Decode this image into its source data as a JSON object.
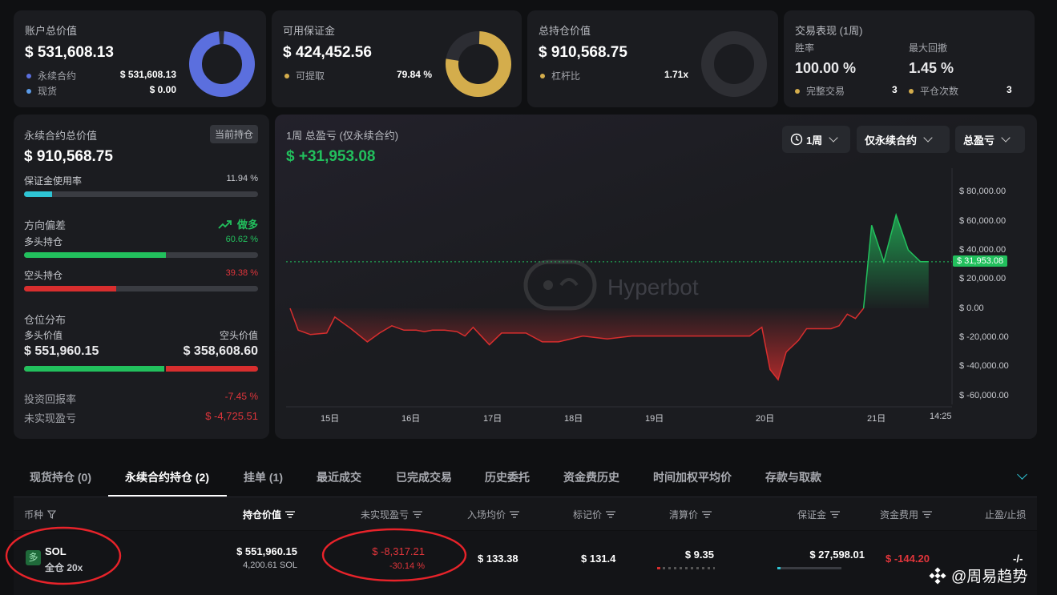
{
  "colors": {
    "accent_blue": "#5b6fde",
    "gold": "#d4ad4c",
    "green": "#22c05d",
    "red": "#e0353b",
    "teal": "#2ec4d4"
  },
  "cards": {
    "account": {
      "title": "账户总价值",
      "value": "$ 531,608.13",
      "rows": [
        {
          "label": "永续合约",
          "value": "$ 531,608.13"
        },
        {
          "label": "现货",
          "value": "$ 0.00"
        }
      ],
      "donut_fraction": 1.0
    },
    "margin": {
      "title": "可用保证金",
      "value": "$ 424,452.56",
      "rows": [
        {
          "label": "可提取",
          "value": "79.84 %"
        }
      ],
      "donut_fraction": 0.7984
    },
    "position": {
      "title": "总持仓价值",
      "value": "$ 910,568.75",
      "rows": [
        {
          "label": "杠杆比",
          "value": "1.71x"
        }
      ],
      "donut_fraction": 0.02
    },
    "perf": {
      "title": "交易表现 (1周)",
      "win_label": "胜率",
      "win_value": "100.00 %",
      "dd_label": "最大回撤",
      "dd_value": "1.45 %",
      "trades_label": "完整交易",
      "trades_value": "3",
      "close_label": "平仓次数",
      "close_value": "3"
    }
  },
  "left": {
    "title": "永续合约总价值",
    "badge": "当前持仓",
    "value": "$ 910,568.75",
    "margin_label": "保证金使用率",
    "margin_value": "11.94 %",
    "margin_fraction": 0.1194,
    "bias_label": "方向偏差",
    "bias_value": "做多",
    "long_label": "多头持仓",
    "long_value": "60.62 %",
    "long_fraction": 0.6062,
    "short_label": "空头持仓",
    "short_value": "39.38 %",
    "short_fraction": 0.3938,
    "dist_label": "仓位分布",
    "long_val_label": "多头价值",
    "short_val_label": "空头价值",
    "long_val": "$ 551,960.15",
    "short_val": "$ 358,608.60",
    "dist_fraction": 0.6062,
    "roi_label": "投资回报率",
    "roi_value": "-7.45 %",
    "upnl_label": "未实现盈亏",
    "upnl_value": "$ -4,725.51"
  },
  "chart_card": {
    "title": "1周 总盈亏 (仅永续合约)",
    "value": "$ +31,953.08",
    "dd_period": "1周",
    "dd_scope": "仅永续合约",
    "dd_metric": "总盈亏",
    "watermark": "Hyperbot",
    "current_label": "$ 31,953.08"
  },
  "chart_data": {
    "type": "area",
    "x_ticks": [
      "15日",
      "16日",
      "17日",
      "18日",
      "19日",
      "20日",
      "21日",
      "14:25"
    ],
    "y_ticks": [
      "$ 80,000.00",
      "$ 60,000.00",
      "$ 40,000.00",
      "$ 20,000.00",
      "$ 0.00",
      "$ -20,000.00",
      "$ -40,000.00",
      "$ -60,000.00"
    ],
    "ylim": [
      -65000,
      95000
    ],
    "current": 31953.08,
    "x": [
      0,
      0.1,
      0.25,
      0.45,
      0.55,
      0.75,
      0.95,
      1.1,
      1.25,
      1.4,
      1.55,
      1.65,
      1.75,
      1.9,
      2.05,
      2.15,
      2.25,
      2.45,
      2.6,
      2.75,
      2.9,
      3.1,
      3.3,
      3.6,
      3.9,
      4.2,
      4.5,
      4.8,
      5.1,
      5.4,
      5.65,
      5.8,
      5.9,
      6.0,
      6.1,
      6.25,
      6.35,
      6.5,
      6.65,
      6.75,
      6.85,
      6.95,
      7.05,
      7.15,
      7.3,
      7.45,
      7.6,
      7.75,
      7.85
    ],
    "y": [
      0,
      -15000,
      -18000,
      -17000,
      -6000,
      -14000,
      -23000,
      -17000,
      -12000,
      -15000,
      -15000,
      -16000,
      -15000,
      -15000,
      -16000,
      -19000,
      -13000,
      -25000,
      -17000,
      -17000,
      -17000,
      -23000,
      -23000,
      -19000,
      -21000,
      -19000,
      -19000,
      -19000,
      -19000,
      -19000,
      -19000,
      -13000,
      -42000,
      -49000,
      -30000,
      -22000,
      -14000,
      -14000,
      -14000,
      -12000,
      -4000,
      -7000,
      0,
      57000,
      32000,
      64000,
      40000,
      32000,
      32000
    ]
  },
  "tabs": [
    "现货持仓 (0)",
    "永续合约持仓 (2)",
    "挂单 (1)",
    "最近成交",
    "已完成交易",
    "历史委托",
    "资金费历史",
    "时间加权平均价",
    "存款与取款"
  ],
  "table": {
    "headers": [
      "币种",
      "持仓价值",
      "未实现盈亏",
      "入场均价",
      "标记价",
      "清算价",
      "保证金",
      "资金费用",
      "止盈/止损"
    ],
    "row": {
      "side": "多",
      "coin": "SOL",
      "mode": "全仓 20x",
      "value": "$ 551,960.15",
      "size": "4,200.61 SOL",
      "upnl": "$ -8,317.21",
      "upnl_pct": "-30.14 %",
      "entry": "$ 133.38",
      "mark": "$ 131.4",
      "liq": "$ 9.35",
      "margin": "$ 27,598.01",
      "funding": "$ -144.20",
      "tpsl": "-/-"
    }
  },
  "watermark_brand": "@周易趋势"
}
